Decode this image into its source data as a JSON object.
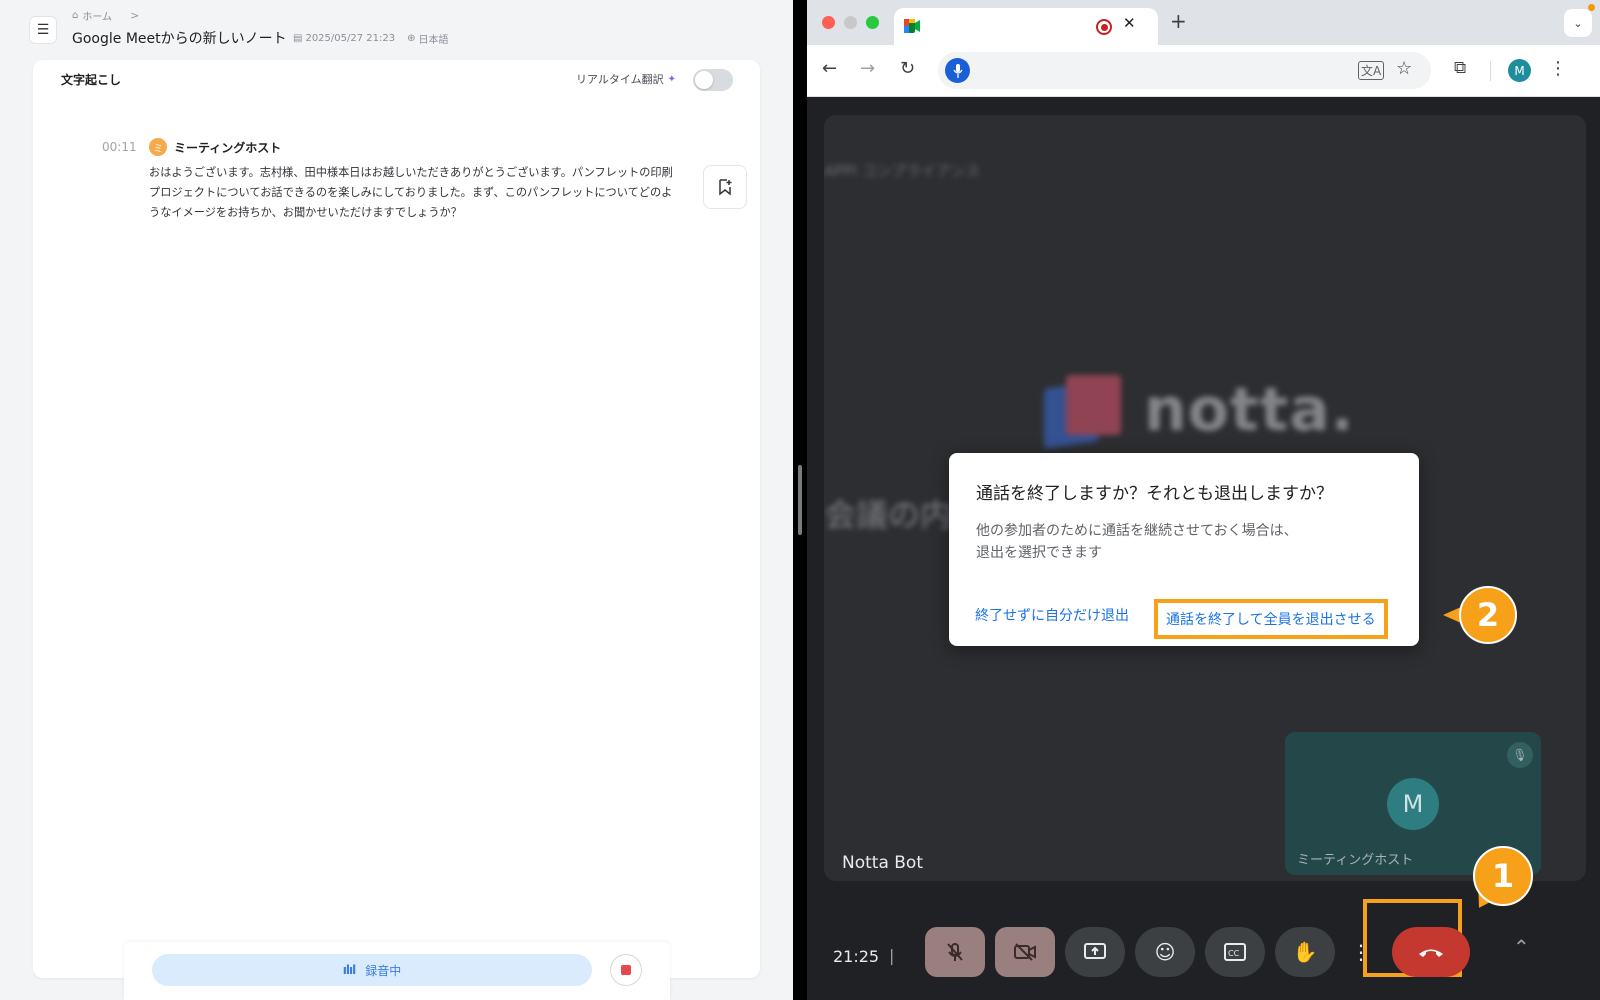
{
  "notta": {
    "breadcrumb": {
      "home": "ホーム",
      "chevron": ">"
    },
    "title": "Google Meetからの新しいノート",
    "meta": {
      "datetime": "2025/05/27 21:23",
      "language": "日本語"
    },
    "section_label": "文字起こし",
    "realtime_translate_label": "リアルタイム翻訳",
    "realtime_translate_on": false,
    "entry": {
      "timestamp": "00:11",
      "speaker_initial": "ミ",
      "speaker": "ミーティングホスト",
      "text": "おはようございます。志村様、田中様本日はお越しいただきありがとうございます。パンフレットの印刷プロジェクトについてお話できるのを楽しみにしておりました。まず、このパンフレットについてどのようなイメージをお持ちか、お聞かせいただけますでしょうか？"
    },
    "recording_label": "録音中"
  },
  "browser": {
    "new_tab_symbol": "+",
    "tab_close_symbol": "✕",
    "profile_initial": "M"
  },
  "meet": {
    "blurred_header_text": "APPI コンプライアンス",
    "brand_text": "notta.",
    "blurred_caption_text": "会議の内容を記録しておりますので、",
    "presenter_label": "Notta Bot",
    "self_tile": {
      "initial": "M",
      "name": "ミーティングホスト"
    },
    "clock": "21:25",
    "clock_separator": "|",
    "dialog": {
      "title": "通話を終了しますか？それとも退出しますか？",
      "body_line1": "他の参加者のために通話を継続させておく場合は、",
      "body_line2": "退出を選択できます",
      "leave_label": "終了せずに自分だけ退出",
      "end_all_label": "通話を終了して全員を退出させる"
    },
    "step_badges": {
      "first": "1",
      "second": "2"
    }
  },
  "colors": {
    "accent_orange": "#f7a11a",
    "meet_blue": "#1a73e8",
    "hangup_red": "#c5382f",
    "notta_recording_blue": "#3b7ddd"
  }
}
